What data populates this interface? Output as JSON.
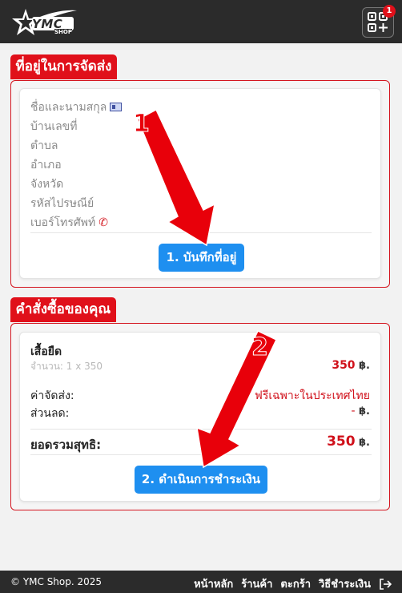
{
  "header": {
    "logo_text": "YMC",
    "logo_sub": "SHOP",
    "qr_badge_count": "1"
  },
  "address_section": {
    "title": "ที่อยู่ในการจัดส่ง",
    "fields": [
      "ชื่อและนามสกุล",
      "บ้านเลขที่",
      "ตำบล",
      "อำเภอ",
      "จังหวัด",
      "รหัสไปรษณีย์",
      "เบอร์โทรศัพท์"
    ],
    "save_button": "1. บันทึกที่อยู่"
  },
  "order_section": {
    "title": "คำสั่งซื้อของคุณ",
    "item_name": "เสื้อยืด",
    "item_qty": "จำนวน: 1 x 350",
    "item_price": "350",
    "shipping_label": "ค่าจัดส่ง:",
    "shipping_value": "ฟรีเฉพาะในประเทศไทย",
    "discount_label": "ส่วนลด:",
    "discount_value": "-",
    "total_label": "ยอดรวมสุทธิ:",
    "total_value": "350",
    "currency": "฿.",
    "checkout_button": "2. ดำเนินการชำระเงิน"
  },
  "annotations": {
    "step1": "1",
    "step2": "2"
  },
  "footer": {
    "copyright": "© YMC Shop. 2025",
    "nav": [
      "หน้าหลัก",
      "ร้านค้า",
      "ตะกร้า",
      "วิธีชำระเงิน"
    ]
  },
  "colors": {
    "accent_red": "#e0101a",
    "button_blue": "#1e8ff0",
    "topbar": "#2b2b2b"
  }
}
